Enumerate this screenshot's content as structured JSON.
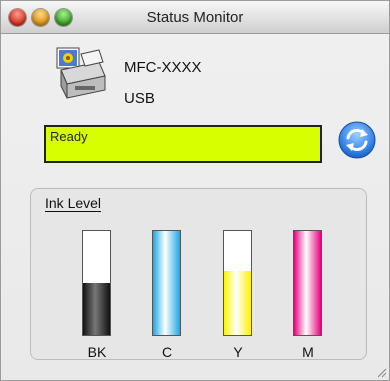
{
  "window": {
    "title": "Status Monitor"
  },
  "device": {
    "model": "MFC-XXXX",
    "connection": "USB",
    "icon": "printer-icon"
  },
  "status": {
    "text": "Ready",
    "color": "#d8ff00"
  },
  "refresh": {
    "icon": "refresh-icon"
  },
  "ink": {
    "group_label": "Ink Level",
    "cartridges": [
      {
        "label": "BK",
        "level": 0.5,
        "color": "#111111"
      },
      {
        "label": "C",
        "level": 1.0,
        "color": "#1aa6e8"
      },
      {
        "label": "Y",
        "level": 0.62,
        "color": "#fff200"
      },
      {
        "label": "M",
        "level": 1.0,
        "color": "#e6007e"
      }
    ]
  }
}
